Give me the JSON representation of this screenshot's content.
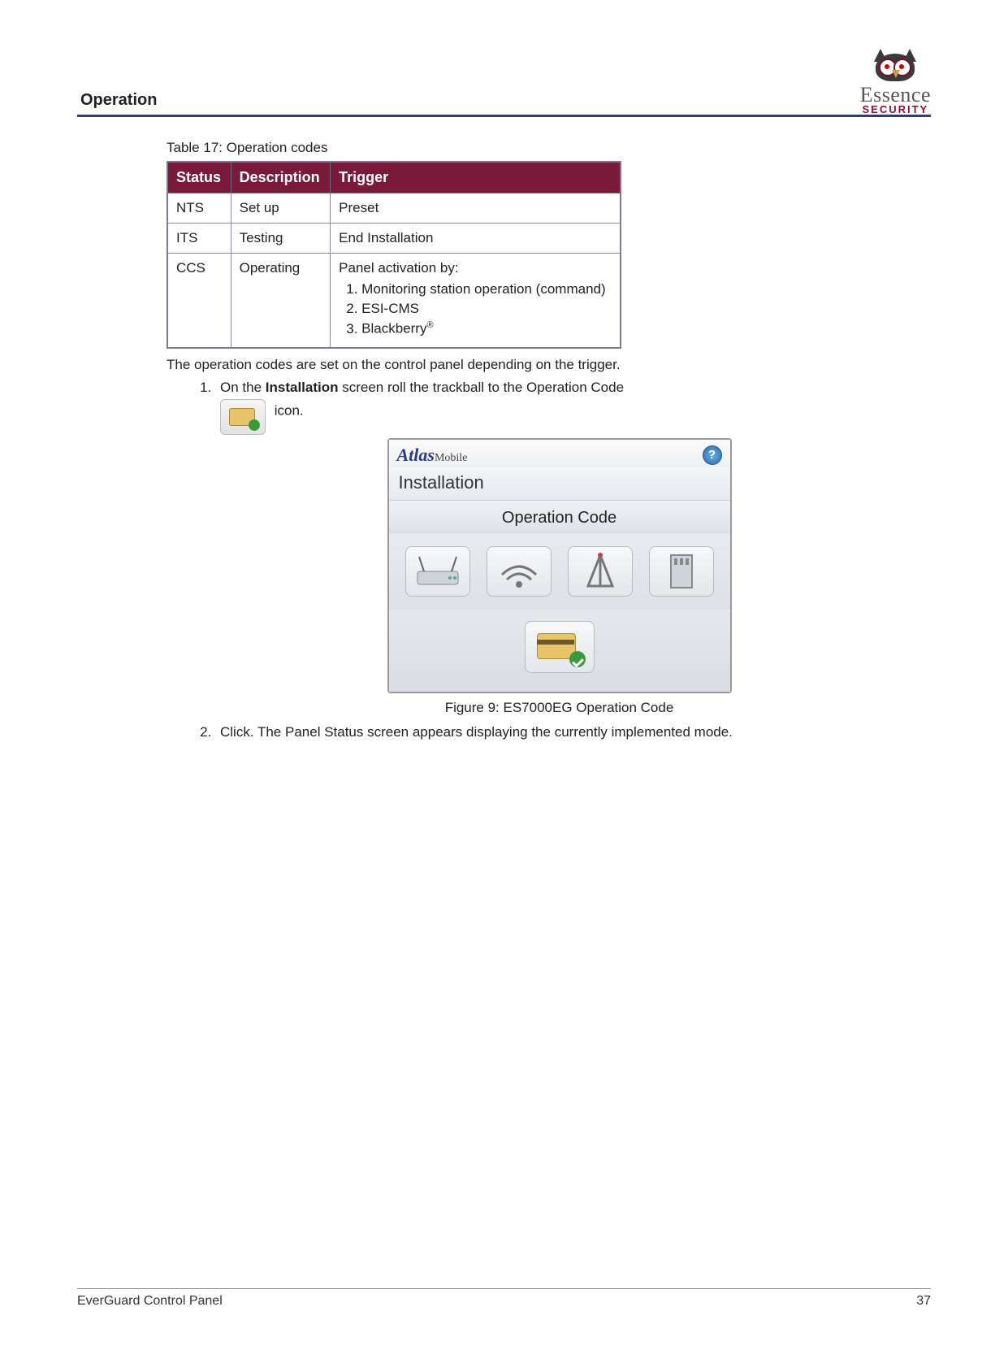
{
  "header": {
    "section": "Operation"
  },
  "logo": {
    "brand": "Essence",
    "sub": "SECURITY"
  },
  "table": {
    "caption": "Table 17: Operation codes",
    "headers": [
      "Status",
      "Description",
      "Trigger"
    ],
    "rows": [
      {
        "status": "NTS",
        "desc": "Set up",
        "trigger_text": "Preset"
      },
      {
        "status": "ITS",
        "desc": "Testing",
        "trigger_text": "End Installation"
      },
      {
        "status": "CCS",
        "desc": "Operating",
        "trigger_text": "Panel activation by:",
        "trigger_list": [
          "Monitoring station operation (command)",
          "ESI-CMS",
          "Blackberry"
        ],
        "trigger_list_suffix": "®"
      }
    ]
  },
  "para1": "The operation codes are set on the control panel depending on the trigger.",
  "steps": {
    "s1a": "On the ",
    "s1b": "Installation",
    "s1c": " screen roll the trackball to the Operation Code ",
    "s1d": " icon.",
    "s2": "Click. The Panel Status screen appears displaying the currently implemented mode."
  },
  "device": {
    "brand_a": "Atlas",
    "brand_b": "Mobile",
    "help": "?",
    "title": "Installation",
    "subtitle": "Operation Code"
  },
  "figure_caption": "Figure 9: ES7000EG Operation Code",
  "footer": {
    "left": "EverGuard Control Panel",
    "right": "37"
  }
}
